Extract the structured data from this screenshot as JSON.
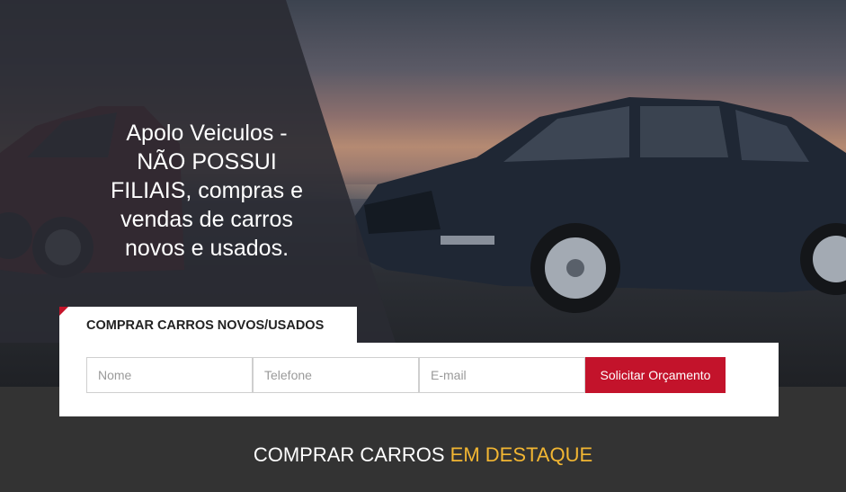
{
  "hero": {
    "headline": "Apolo Veiculos - NÃO POSSUI FILIAIS, compras e vendas de carros novos e usados."
  },
  "form": {
    "tab_label": "COMPRAR CARROS NOVOS/USADOS",
    "fields": [
      {
        "placeholder": "Nome",
        "value": ""
      },
      {
        "placeholder": "Telefone",
        "value": ""
      },
      {
        "placeholder": "E-mail",
        "value": ""
      }
    ],
    "submit_label": "Solicitar Orçamento"
  },
  "featured": {
    "title_main": "COMPRAR CARROS",
    "title_highlight": "EM DESTAQUE"
  },
  "colors": {
    "accent_red": "#c3132b",
    "highlight_yellow": "#f2b632",
    "dark_bg": "#333333"
  }
}
